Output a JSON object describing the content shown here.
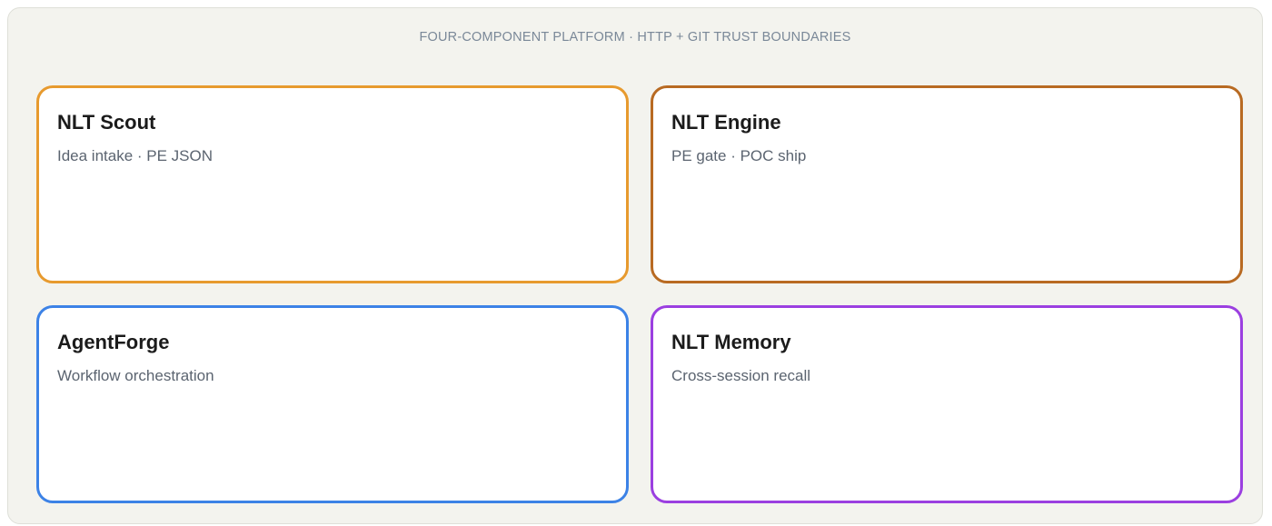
{
  "diagram": {
    "title": "FOUR-COMPONENT PLATFORM · HTTP + GIT TRUST BOUNDARIES",
    "components": [
      {
        "name": "NLT Scout",
        "description": "Idea intake · PE JSON",
        "color": "#e79a2e"
      },
      {
        "name": "NLT Engine",
        "description": "PE gate · POC ship",
        "color": "#b86a22"
      },
      {
        "name": "AgentForge",
        "description": "Workflow orchestration",
        "color": "#3c82e6"
      },
      {
        "name": "NLT Memory",
        "description": "Cross-session recall",
        "color": "#9b3fe0"
      }
    ]
  }
}
